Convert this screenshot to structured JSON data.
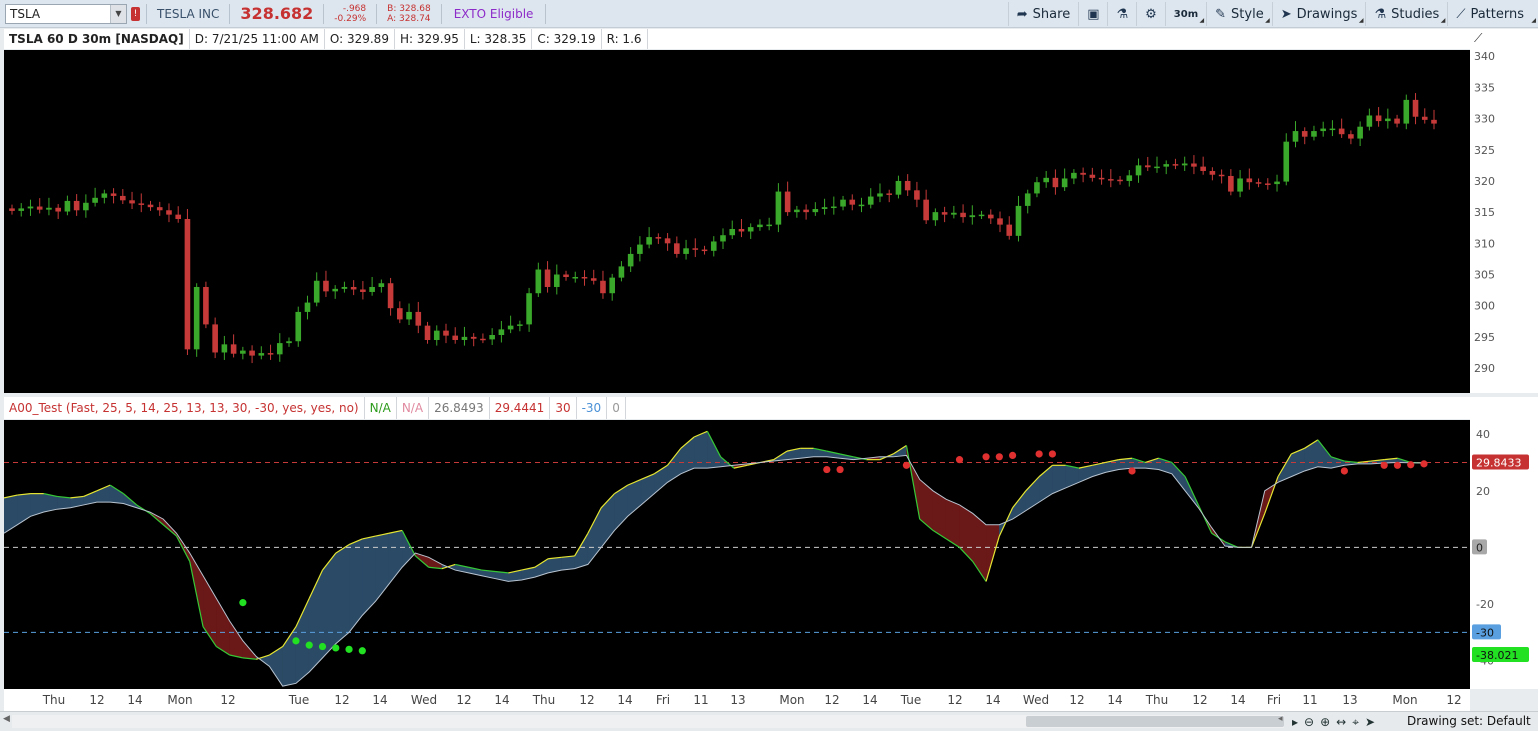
{
  "toolbar": {
    "symbol": "TSLA",
    "alert_badge": "!",
    "company": "TESLA INC",
    "last": "328.682",
    "change": "-.968",
    "change_pct": "-0.29%",
    "bid": "B: 328.68",
    "ask": "A: 328.74",
    "exto": "EXTO Eligible",
    "buttons": {
      "share": "Share",
      "interval": "30m",
      "style": "Style",
      "drawings": "Drawings",
      "studies": "Studies",
      "patterns": "Patterns"
    }
  },
  "infobar": {
    "title": "TSLA 60 D 30m [NASDAQ]",
    "date": "D: 7/21/25 11:00 AM",
    "open": "O: 329.89",
    "high": "H: 329.95",
    "low": "L: 328.35",
    "close": "C: 329.19",
    "range": "R: 1.6"
  },
  "study": {
    "title": "A00_Test (Fast, 25, 5, 14, 25, 13, 13, 30, -30, yes, yes, no)",
    "v1": "N/A",
    "v2": "N/A",
    "v3": "26.8493",
    "v4": "29.4441",
    "v5": "30",
    "v6": "-30",
    "v7": "0"
  },
  "bottom": {
    "drawing_set": "Drawing set: Default"
  },
  "colors": {
    "up": "#3aa82a",
    "down": "#c73a3a",
    "upper_line": "#c73a3a",
    "lower_line": "#5aa0e0",
    "zero_line": "#cccccc",
    "fill_up": "#2b4a66",
    "fill_down": "#6a1818",
    "dot_red": "#e03030",
    "dot_green": "#22e022"
  },
  "chart_data": [
    {
      "type": "candlestick",
      "title": "TSLA 60 D 30m [NASDAQ]",
      "ylim": [
        286,
        341
      ],
      "yticks": [
        290,
        295,
        300,
        305,
        310,
        315,
        320,
        325,
        330,
        335,
        340
      ],
      "xticks": [
        "Thu",
        "12",
        "14",
        "Mon",
        "12",
        "Tue",
        "12",
        "14",
        "Wed",
        "12",
        "14",
        "Thu",
        "12",
        "14",
        "Fri",
        "11",
        "13",
        "Mon",
        "12",
        "14",
        "Tue",
        "12",
        "14",
        "Wed",
        "12",
        "14",
        "Thu",
        "12",
        "14",
        "Fri",
        "11",
        "13",
        "Mon",
        "12"
      ],
      "close": [
        315.2,
        315.6,
        315.9,
        315.4,
        315.7,
        315.1,
        316.8,
        315.3,
        316.5,
        317.3,
        318.0,
        317.6,
        316.9,
        316.4,
        316.2,
        315.8,
        315.3,
        314.6,
        313.9,
        293.0,
        303.0,
        297.0,
        292.5,
        293.8,
        292.3,
        292.8,
        292.0,
        292.4,
        292.2,
        294.0,
        294.3,
        299.0,
        300.5,
        304.0,
        302.3,
        302.7,
        303.0,
        302.6,
        302.2,
        303.0,
        303.6,
        299.6,
        297.8,
        299.0,
        296.8,
        294.5,
        296.0,
        295.2,
        294.5,
        295.0,
        294.7,
        294.6,
        295.3,
        296.2,
        296.8,
        297.0,
        302.0,
        305.8,
        303.0,
        305.0,
        304.6,
        304.6,
        304.4,
        304.0,
        302.0,
        304.5,
        306.3,
        308.3,
        309.8,
        311.0,
        310.8,
        310.0,
        308.3,
        309.2,
        309.0,
        308.8,
        310.3,
        311.3,
        312.3,
        311.9,
        312.6,
        313.0,
        313.0,
        318.3,
        315.0,
        315.4,
        315.0,
        315.5,
        315.8,
        315.9,
        317.0,
        316.2,
        316.2,
        317.5,
        318.0,
        317.8,
        320.0,
        318.5,
        317.0,
        313.7,
        315.0,
        314.6,
        314.9,
        314.2,
        314.5,
        314.6,
        314.0,
        313.0,
        311.2,
        316.0,
        318.0,
        319.8,
        320.5,
        319.0,
        320.4,
        321.3,
        321.0,
        320.5,
        320.3,
        320.2,
        320.0,
        320.9,
        322.5,
        322.2,
        322.3,
        322.7,
        322.5,
        322.8,
        322.3,
        321.6,
        321.0,
        320.8,
        318.3,
        320.4,
        319.8,
        319.6,
        319.5,
        319.9,
        326.3,
        328.0,
        327.1,
        328.0,
        328.4,
        328.4,
        327.5,
        326.8,
        328.7,
        330.5,
        329.6,
        330.0,
        329.2,
        333.0,
        330.3,
        329.8,
        329.2
      ],
      "open": [
        315.6,
        315.2,
        315.6,
        315.9,
        315.4,
        315.7,
        315.1,
        316.8,
        315.3,
        316.5,
        317.3,
        318.0,
        317.6,
        316.9,
        316.4,
        316.2,
        315.8,
        315.3,
        314.6,
        313.9,
        293.0,
        303.0,
        297.0,
        292.5,
        293.8,
        292.3,
        292.8,
        292.0,
        292.4,
        292.2,
        294.0,
        294.3,
        299.0,
        300.5,
        304.0,
        302.3,
        302.7,
        303.0,
        302.6,
        302.2,
        303.0,
        303.6,
        299.6,
        297.8,
        299.0,
        296.8,
        294.5,
        296.0,
        295.2,
        294.5,
        295.0,
        294.7,
        294.6,
        295.3,
        296.2,
        296.8,
        297.0,
        302.0,
        305.8,
        303.0,
        305.0,
        304.6,
        304.6,
        304.4,
        304.0,
        302.0,
        304.5,
        306.3,
        308.3,
        309.8,
        311.0,
        310.8,
        310.0,
        308.3,
        309.2,
        309.0,
        308.8,
        310.3,
        311.3,
        312.3,
        311.9,
        312.6,
        313.0,
        313.0,
        318.3,
        315.0,
        315.4,
        315.0,
        315.5,
        315.8,
        315.9,
        317.0,
        316.2,
        316.2,
        317.5,
        318.0,
        317.8,
        320.0,
        318.5,
        317.0,
        313.7,
        315.0,
        314.6,
        314.9,
        314.2,
        314.5,
        314.6,
        314.0,
        313.0,
        311.2,
        316.0,
        318.0,
        319.8,
        320.5,
        319.0,
        320.4,
        321.3,
        321.0,
        320.5,
        320.3,
        320.2,
        320.0,
        320.9,
        322.5,
        322.2,
        322.3,
        322.7,
        322.5,
        322.8,
        322.3,
        321.6,
        321.0,
        320.8,
        318.3,
        320.4,
        319.8,
        319.6,
        319.5,
        319.9,
        326.3,
        328.0,
        327.1,
        328.0,
        328.4,
        328.4,
        327.5,
        326.8,
        328.7,
        330.5,
        329.6,
        330.0,
        329.2,
        333.0,
        330.3,
        329.8
      ]
    },
    {
      "type": "area",
      "title": "A00_Test (Fast, 25, 5, 14, 25, 13, 13, 30, -30, yes, yes, no)",
      "ylim": [
        -50,
        45
      ],
      "yticks": [
        40,
        20,
        -20,
        -40
      ],
      "hlines": [
        30,
        0,
        -30
      ],
      "labels": {
        "current_fast": "29.8433",
        "zero": "0",
        "lower": "-30",
        "current_slow": "-38.021"
      },
      "fast": [
        17.5,
        18.5,
        19.0,
        19.0,
        18.0,
        17.5,
        18.0,
        20.0,
        22.0,
        19.0,
        15.0,
        12.0,
        8.0,
        4.0,
        -5.0,
        -28.0,
        -35.0,
        -38.0,
        -39.0,
        -39.5,
        -38.0,
        -35.0,
        -28.0,
        -18.0,
        -8.0,
        -2.0,
        1.0,
        3.0,
        4.0,
        5.0,
        6.0,
        -3.0,
        -7.0,
        -7.5,
        -6.0,
        -7.0,
        -8.0,
        -8.5,
        -9.0,
        -8.0,
        -7.0,
        -4.0,
        -3.5,
        -3.0,
        5.0,
        14.0,
        19.0,
        22.0,
        24.0,
        26.0,
        29.0,
        35.0,
        39.0,
        41.0,
        32.0,
        28.0,
        29.0,
        30.0,
        31.0,
        34.0,
        35.0,
        35.0,
        34.0,
        33.0,
        32.0,
        31.0,
        31.0,
        33.0,
        36.0,
        10.0,
        6.0,
        3.0,
        0.0,
        -5.0,
        -12.0,
        4.0,
        14.0,
        20.0,
        25.0,
        29.0,
        29.0,
        28.0,
        29.0,
        30.0,
        31.0,
        31.5,
        30.0,
        31.5,
        30.0,
        25.0,
        15.0,
        5.0,
        2.0,
        0.0,
        0.0,
        12.0,
        25.0,
        33.0,
        35.0,
        38.0,
        32.0,
        30.5,
        30.0,
        30.5,
        31.0,
        31.5,
        30.0,
        29.8
      ],
      "slow": [
        5.0,
        8.0,
        11.0,
        12.5,
        13.5,
        14.0,
        15.0,
        16.0,
        16.0,
        15.5,
        14.0,
        12.5,
        10.0,
        5.0,
        -2.0,
        -10.0,
        -18.0,
        -26.0,
        -33.0,
        -38.5,
        -42.0,
        -49.0,
        -48.0,
        -44.0,
        -39.0,
        -34.0,
        -30.0,
        -24.0,
        -19.0,
        -13.0,
        -7.0,
        -2.0,
        -3.5,
        -6.0,
        -8.0,
        -9.0,
        -10.0,
        -11.0,
        -12.0,
        -11.5,
        -10.5,
        -9.0,
        -8.0,
        -7.5,
        -6.0,
        0.0,
        6.0,
        11.0,
        15.0,
        19.0,
        23.0,
        26.0,
        28.0,
        28.0,
        28.5,
        29.0,
        29.5,
        30.0,
        30.5,
        31.0,
        31.5,
        32.0,
        32.0,
        31.5,
        31.0,
        31.5,
        32.0,
        32.0,
        32.5,
        24.0,
        20.0,
        17.0,
        15.0,
        12.0,
        8.0,
        8.0,
        10.0,
        13.0,
        16.0,
        19.0,
        21.0,
        23.0,
        25.0,
        26.5,
        27.5,
        28.0,
        28.0,
        27.5,
        26.0,
        20.0,
        14.0,
        7.0,
        0.5,
        0.0,
        0.0,
        20.0,
        23.0,
        25.0,
        27.0,
        28.5,
        28.0,
        29.0,
        29.5,
        29.5,
        29.8,
        30.0,
        29.9,
        29.8
      ],
      "red_dots": [
        [
          62,
          27.5
        ],
        [
          63,
          27.5
        ],
        [
          68,
          29.0
        ],
        [
          72,
          31.0
        ],
        [
          74,
          32.0
        ],
        [
          75,
          32.0
        ],
        [
          76,
          32.5
        ],
        [
          78,
          33.0
        ],
        [
          79,
          33.0
        ],
        [
          85,
          27.0
        ],
        [
          101,
          27.0
        ],
        [
          104,
          29.0
        ],
        [
          105,
          29.0
        ],
        [
          106,
          29.2
        ],
        [
          107,
          29.5
        ]
      ],
      "green_dots": [
        [
          18,
          -19.5
        ],
        [
          22,
          -33.0
        ],
        [
          23,
          -34.5
        ],
        [
          24,
          -35.0
        ],
        [
          25,
          -35.5
        ],
        [
          26,
          -36.0
        ],
        [
          27,
          -36.5
        ]
      ]
    }
  ]
}
